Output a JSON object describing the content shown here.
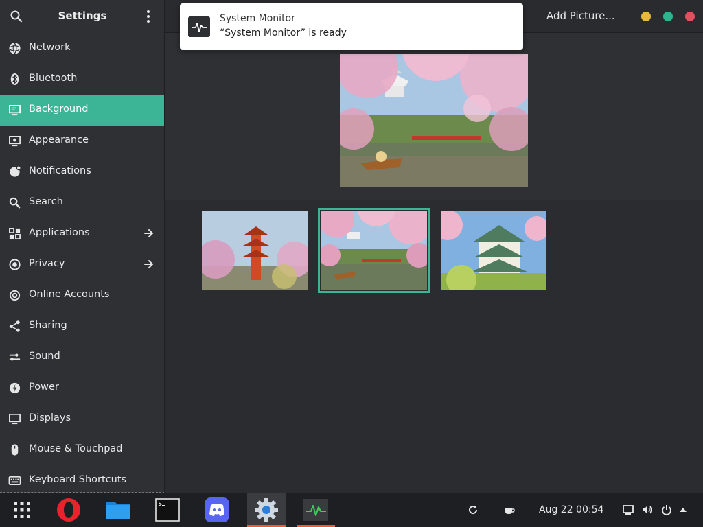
{
  "window": {
    "title": "Settings",
    "add_picture_label": "Add Picture...",
    "controls": {
      "minimize_color": "#e9b93b",
      "maximize_color": "#2db48e",
      "close_color": "#e0505e"
    }
  },
  "accent": "#3bb596",
  "sidebar": {
    "items": [
      {
        "label": "Network",
        "icon": "network-icon"
      },
      {
        "label": "Bluetooth",
        "icon": "bluetooth-icon"
      },
      {
        "label": "Background",
        "icon": "background-icon",
        "active": true
      },
      {
        "label": "Appearance",
        "icon": "appearance-icon"
      },
      {
        "label": "Notifications",
        "icon": "notifications-icon"
      },
      {
        "label": "Search",
        "icon": "search-icon"
      },
      {
        "label": "Applications",
        "icon": "applications-icon",
        "has_arrow": true
      },
      {
        "label": "Privacy",
        "icon": "privacy-icon",
        "has_arrow": true
      },
      {
        "label": "Online Accounts",
        "icon": "online-accounts-icon"
      },
      {
        "label": "Sharing",
        "icon": "sharing-icon"
      },
      {
        "label": "Sound",
        "icon": "sound-icon"
      },
      {
        "label": "Power",
        "icon": "power-icon"
      },
      {
        "label": "Displays",
        "icon": "displays-icon"
      },
      {
        "label": "Mouse & Touchpad",
        "icon": "mouse-icon"
      },
      {
        "label": "Keyboard Shortcuts",
        "icon": "keyboard-icon"
      }
    ]
  },
  "notification": {
    "title": "System Monitor",
    "body": "“System Monitor” is ready",
    "icon": "system-monitor-icon"
  },
  "wallpapers": {
    "preview": "cherry-blossom-castle-river",
    "thumbnails": [
      {
        "name": "pagoda-cherry-blossom",
        "selected": false
      },
      {
        "name": "cherry-blossom-castle-river",
        "selected": true
      },
      {
        "name": "osaka-castle-blossom",
        "selected": false
      }
    ]
  },
  "taskbar": {
    "apps": [
      "app-grid-icon",
      "opera-icon",
      "files-icon",
      "terminal-icon",
      "discord-icon",
      "settings-icon",
      "system-monitor-icon"
    ],
    "active_app": "settings-icon",
    "clock": "Aug 22  00:54",
    "tray": [
      "refresh-icon",
      "coffee-icon",
      "screen-icon",
      "volume-icon",
      "power-icon",
      "tray-up-icon"
    ]
  }
}
